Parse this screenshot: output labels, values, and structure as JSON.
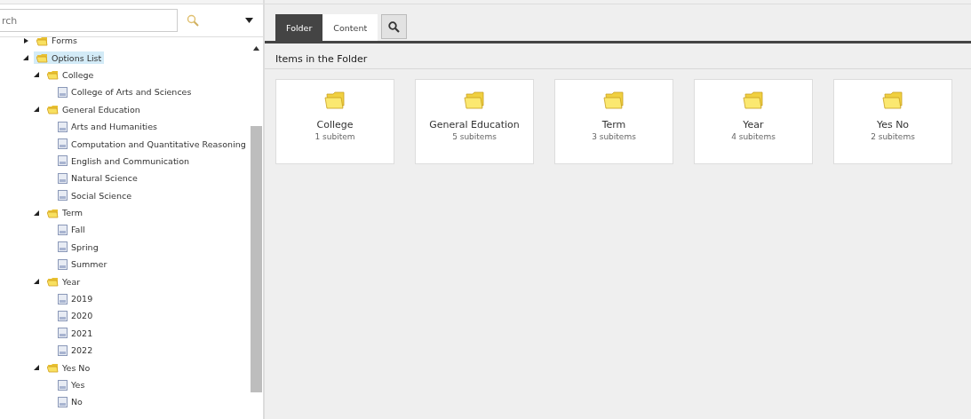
{
  "search": {
    "placeholder": "rch"
  },
  "tree": [
    {
      "label": "Forms",
      "kind": "folder",
      "expanded": false,
      "selected": false
    },
    {
      "label": "Options List",
      "kind": "folder",
      "expanded": true,
      "selected": true,
      "children": [
        {
          "label": "College",
          "kind": "folder",
          "expanded": true,
          "selected": false,
          "children": [
            {
              "label": "College of Arts and Sciences",
              "kind": "document",
              "selected": false
            }
          ]
        },
        {
          "label": "General Education",
          "kind": "folder",
          "expanded": true,
          "selected": false,
          "children": [
            {
              "label": "Arts and Humanities",
              "kind": "document",
              "selected": false
            },
            {
              "label": "Computation and Quantitative Reasoning",
              "kind": "document",
              "selected": false
            },
            {
              "label": "English and Communication",
              "kind": "document",
              "selected": false
            },
            {
              "label": "Natural Science",
              "kind": "document",
              "selected": false
            },
            {
              "label": "Social Science",
              "kind": "document",
              "selected": false
            }
          ]
        },
        {
          "label": "Term",
          "kind": "folder",
          "expanded": true,
          "selected": false,
          "children": [
            {
              "label": "Fall",
              "kind": "document",
              "selected": false
            },
            {
              "label": "Spring",
              "kind": "document",
              "selected": false
            },
            {
              "label": "Summer",
              "kind": "document",
              "selected": false
            }
          ]
        },
        {
          "label": "Year",
          "kind": "folder",
          "expanded": true,
          "selected": false,
          "children": [
            {
              "label": "2019",
              "kind": "document",
              "selected": false
            },
            {
              "label": "2020",
              "kind": "document",
              "selected": false
            },
            {
              "label": "2021",
              "kind": "document",
              "selected": false
            },
            {
              "label": "2022",
              "kind": "document",
              "selected": false
            }
          ]
        },
        {
          "label": "Yes No",
          "kind": "folder",
          "expanded": true,
          "selected": false,
          "children": [
            {
              "label": "Yes",
              "kind": "document",
              "selected": false
            },
            {
              "label": "No",
              "kind": "document",
              "selected": false
            }
          ]
        }
      ]
    }
  ],
  "tabs": [
    {
      "label": "Folder",
      "selected": true
    },
    {
      "label": "Content",
      "selected": false
    }
  ],
  "section_title": "Items in the Folder",
  "folders": [
    {
      "name": "College",
      "count": "1 subitem"
    },
    {
      "name": "General Education",
      "count": "5 subitems"
    },
    {
      "name": "Term",
      "count": "3 subitems"
    },
    {
      "name": "Year",
      "count": "4 subitems"
    },
    {
      "name": "Yes No",
      "count": "2 subitems"
    }
  ]
}
